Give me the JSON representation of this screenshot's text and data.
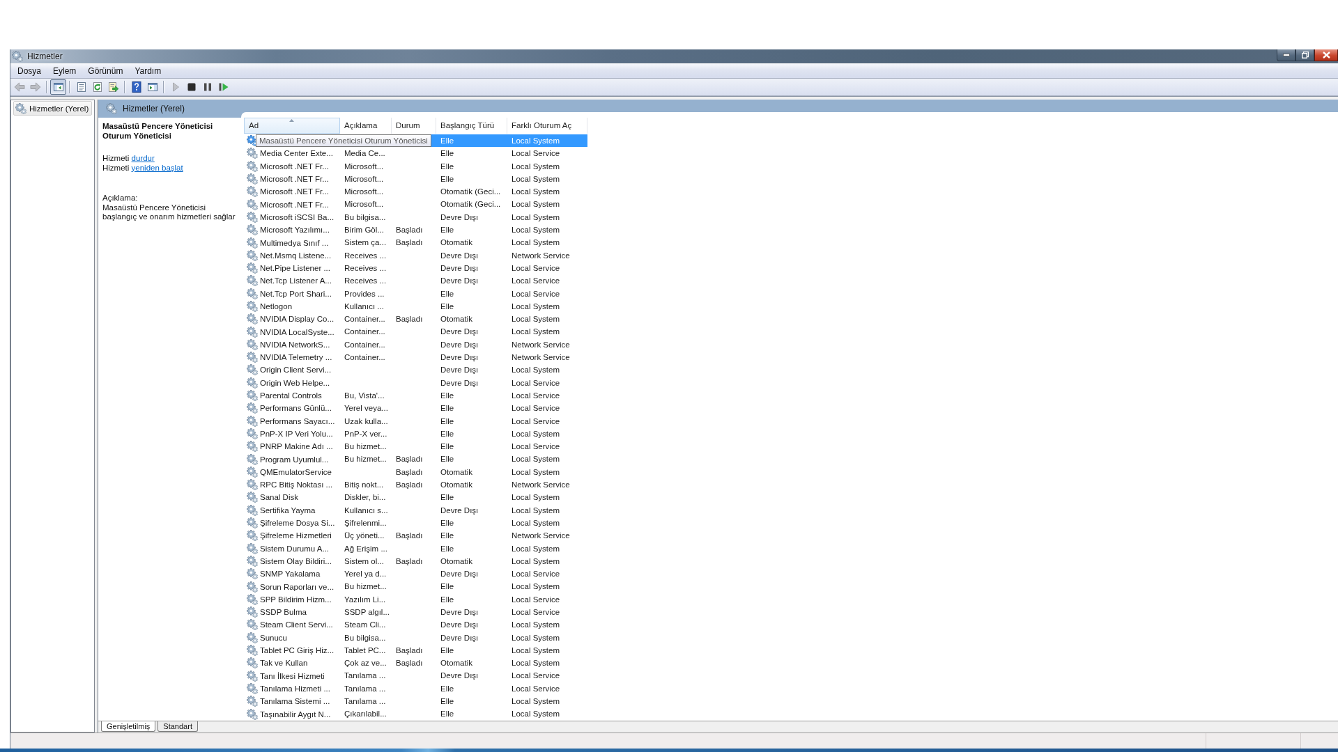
{
  "window": {
    "title": "Hizmetler"
  },
  "menu": [
    "Dosya",
    "Eylem",
    "Görünüm",
    "Yardım"
  ],
  "toolbar": {
    "groups": [
      [
        {
          "kind": "back",
          "disabled": true,
          "pressed": false
        },
        {
          "kind": "forward",
          "disabled": true,
          "pressed": false
        }
      ],
      [
        {
          "kind": "tree",
          "disabled": false,
          "pressed": true
        }
      ],
      [
        {
          "kind": "properties",
          "disabled": false,
          "pressed": false
        },
        {
          "kind": "refresh",
          "disabled": false,
          "pressed": false
        },
        {
          "kind": "export",
          "disabled": false,
          "pressed": false
        }
      ],
      [
        {
          "kind": "help",
          "disabled": false,
          "pressed": false
        },
        {
          "kind": "actions",
          "disabled": false,
          "pressed": false
        }
      ],
      [
        {
          "kind": "start",
          "disabled": true,
          "pressed": false
        },
        {
          "kind": "stop",
          "disabled": false,
          "pressed": false
        },
        {
          "kind": "pause",
          "disabled": false,
          "pressed": false
        },
        {
          "kind": "resume",
          "disabled": false,
          "pressed": false
        }
      ]
    ]
  },
  "tree": {
    "items": [
      {
        "label": "Hizmetler (Yerel)",
        "selected": true
      }
    ]
  },
  "panel": {
    "title": "Hizmetler (Yerel)"
  },
  "details": {
    "title": "Masaüstü Pencere Yöneticisi Oturum Yöneticisi",
    "actions": [
      {
        "text": "Hizmeti",
        "link": "durdur"
      },
      {
        "text": "Hizmeti",
        "link": "yeniden başlat"
      }
    ],
    "description_label": "Açıklama:",
    "description": "Masaüstü Pencere Yöneticisi başlangıç ve onarım hizmetleri sağlar"
  },
  "table": {
    "columns": [
      {
        "label": "Ad",
        "sorted": true
      },
      {
        "label": "Açıklama",
        "sorted": false
      },
      {
        "label": "Durum",
        "sorted": false
      },
      {
        "label": "Başlangıç Türü",
        "sorted": false
      },
      {
        "label": "Farklı Oturum Aç",
        "sorted": false
      }
    ],
    "rows": [
      {
        "name": "Masaüstü Pencere Yöneticisi Oturum Yöneticisi",
        "tooltip": true,
        "startup": "Elle",
        "logon": "Local System",
        "selected": true
      },
      {
        "name": "Media Center Exte...",
        "tooltip": false,
        "description": "Media Ce...",
        "startup": "Elle",
        "logon": "Local Service",
        "selected": false
      },
      {
        "name": "Microsoft .NET Fr...",
        "tooltip": false,
        "description": "Microsoft...",
        "startup": "Elle",
        "logon": "Local System",
        "selected": false
      },
      {
        "name": "Microsoft .NET Fr...",
        "tooltip": false,
        "description": "Microsoft...",
        "startup": "Elle",
        "logon": "Local System",
        "selected": false
      },
      {
        "name": "Microsoft .NET Fr...",
        "tooltip": false,
        "description": "Microsoft...",
        "startup": "Otomatik (Geci...",
        "logon": "Local System",
        "selected": false
      },
      {
        "name": "Microsoft .NET Fr...",
        "tooltip": false,
        "description": "Microsoft...",
        "startup": "Otomatik (Geci...",
        "logon": "Local System",
        "selected": false
      },
      {
        "name": "Microsoft iSCSI Ba...",
        "tooltip": false,
        "description": "Bu bilgisa...",
        "startup": "Devre Dışı",
        "logon": "Local System",
        "selected": false
      },
      {
        "name": "Microsoft Yazılımı...",
        "tooltip": false,
        "description": "Birim Göl...",
        "status": "Başladı",
        "startup": "Elle",
        "logon": "Local System",
        "selected": false
      },
      {
        "name": "Multimedya Sınıf ...",
        "tooltip": false,
        "description": "Sistem ça...",
        "status": "Başladı",
        "startup": "Otomatik",
        "logon": "Local System",
        "selected": false
      },
      {
        "name": "Net.Msmq Listene...",
        "tooltip": false,
        "description": "Receives ...",
        "startup": "Devre Dışı",
        "logon": "Network Service",
        "selected": false
      },
      {
        "name": "Net.Pipe Listener ...",
        "tooltip": false,
        "description": "Receives ...",
        "startup": "Devre Dışı",
        "logon": "Local Service",
        "selected": false
      },
      {
        "name": "Net.Tcp Listener A...",
        "tooltip": false,
        "description": "Receives ...",
        "startup": "Devre Dışı",
        "logon": "Local Service",
        "selected": false
      },
      {
        "name": "Net.Tcp Port Shari...",
        "tooltip": false,
        "description": "Provides ...",
        "startup": "Elle",
        "logon": "Local Service",
        "selected": false
      },
      {
        "name": "Netlogon",
        "tooltip": false,
        "description": "Kullanıcı ...",
        "startup": "Elle",
        "logon": "Local System",
        "selected": false
      },
      {
        "name": "NVIDIA Display Co...",
        "tooltip": false,
        "description": "Container...",
        "status": "Başladı",
        "startup": "Otomatik",
        "logon": "Local System",
        "selected": false
      },
      {
        "name": "NVIDIA LocalSyste...",
        "tooltip": false,
        "description": "Container...",
        "startup": "Devre Dışı",
        "logon": "Local System",
        "selected": false
      },
      {
        "name": "NVIDIA NetworkS...",
        "tooltip": false,
        "description": "Container...",
        "startup": "Devre Dışı",
        "logon": "Network Service",
        "selected": false
      },
      {
        "name": "NVIDIA Telemetry ...",
        "tooltip": false,
        "description": "Container...",
        "startup": "Devre Dışı",
        "logon": "Network Service",
        "selected": false
      },
      {
        "name": "Origin Client Servi...",
        "tooltip": false,
        "startup": "Devre Dışı",
        "logon": "Local System",
        "selected": false
      },
      {
        "name": "Origin Web Helpe...",
        "tooltip": false,
        "startup": "Devre Dışı",
        "logon": "Local Service",
        "selected": false
      },
      {
        "name": "Parental Controls",
        "tooltip": false,
        "description": "Bu, Vista'...",
        "startup": "Elle",
        "logon": "Local Service",
        "selected": false
      },
      {
        "name": "Performans Günlü...",
        "tooltip": false,
        "description": "Yerel veya...",
        "startup": "Elle",
        "logon": "Local Service",
        "selected": false
      },
      {
        "name": "Performans Sayacı...",
        "tooltip": false,
        "description": "Uzak kulla...",
        "startup": "Elle",
        "logon": "Local Service",
        "selected": false
      },
      {
        "name": "PnP-X IP Veri Yolu...",
        "tooltip": false,
        "description": "PnP-X ver...",
        "startup": "Elle",
        "logon": "Local System",
        "selected": false
      },
      {
        "name": "PNRP Makine Adı ...",
        "tooltip": false,
        "description": "Bu hizmet...",
        "startup": "Elle",
        "logon": "Local Service",
        "selected": false
      },
      {
        "name": "Program Uyumlul...",
        "tooltip": false,
        "description": "Bu hizmet...",
        "status": "Başladı",
        "startup": "Elle",
        "logon": "Local System",
        "selected": false
      },
      {
        "name": "QMEmulatorService",
        "tooltip": false,
        "status": "Başladı",
        "startup": "Otomatik",
        "logon": "Local System",
        "selected": false
      },
      {
        "name": "RPC Bitiş Noktası ...",
        "tooltip": false,
        "description": "Bitiş nokt...",
        "status": "Başladı",
        "startup": "Otomatik",
        "logon": "Network Service",
        "selected": false
      },
      {
        "name": "Sanal Disk",
        "tooltip": false,
        "description": "Diskler, bi...",
        "startup": "Elle",
        "logon": "Local System",
        "selected": false
      },
      {
        "name": "Sertifika Yayma",
        "tooltip": false,
        "description": "Kullanıcı s...",
        "startup": "Devre Dışı",
        "logon": "Local System",
        "selected": false
      },
      {
        "name": "Şifreleme Dosya Si...",
        "tooltip": false,
        "description": "Şifrelenmi...",
        "startup": "Elle",
        "logon": "Local System",
        "selected": false
      },
      {
        "name": "Şifreleme Hizmetleri",
        "tooltip": false,
        "description": "Üç yöneti...",
        "status": "Başladı",
        "startup": "Elle",
        "logon": "Network Service",
        "selected": false
      },
      {
        "name": "Sistem Durumu A...",
        "tooltip": false,
        "description": "Ağ Erişim ...",
        "startup": "Elle",
        "logon": "Local System",
        "selected": false
      },
      {
        "name": "Sistem Olay Bildiri...",
        "tooltip": false,
        "description": "Sistem ol...",
        "status": "Başladı",
        "startup": "Otomatik",
        "logon": "Local System",
        "selected": false
      },
      {
        "name": "SNMP Yakalama",
        "tooltip": false,
        "description": "Yerel ya d...",
        "startup": "Devre Dışı",
        "logon": "Local Service",
        "selected": false
      },
      {
        "name": "Sorun Raporları ve...",
        "tooltip": false,
        "description": "Bu hizmet...",
        "startup": "Elle",
        "logon": "Local System",
        "selected": false
      },
      {
        "name": "SPP Bildirim Hizm...",
        "tooltip": false,
        "description": "Yazılım Li...",
        "startup": "Elle",
        "logon": "Local Service",
        "selected": false
      },
      {
        "name": "SSDP Bulma",
        "tooltip": false,
        "description": "SSDP algıl...",
        "startup": "Devre Dışı",
        "logon": "Local Service",
        "selected": false
      },
      {
        "name": "Steam Client Servi...",
        "tooltip": false,
        "description": "Steam Cli...",
        "startup": "Devre Dışı",
        "logon": "Local System",
        "selected": false
      },
      {
        "name": "Sunucu",
        "tooltip": false,
        "description": "Bu bilgisa...",
        "startup": "Devre Dışı",
        "logon": "Local System",
        "selected": false
      },
      {
        "name": "Tablet PC Giriş Hiz...",
        "tooltip": false,
        "description": "Tablet PC...",
        "status": "Başladı",
        "startup": "Elle",
        "logon": "Local System",
        "selected": false
      },
      {
        "name": "Tak ve Kullan",
        "tooltip": false,
        "description": "Çok az ve...",
        "status": "Başladı",
        "startup": "Otomatik",
        "logon": "Local System",
        "selected": false
      },
      {
        "name": "Tanı İlkesi Hizmeti",
        "tooltip": false,
        "description": "Tanılama ...",
        "startup": "Devre Dışı",
        "logon": "Local Service",
        "selected": false
      },
      {
        "name": "Tanılama Hizmeti ...",
        "tooltip": false,
        "description": "Tanılama ...",
        "startup": "Elle",
        "logon": "Local Service",
        "selected": false
      },
      {
        "name": "Tanılama Sistemi ...",
        "tooltip": false,
        "description": "Tanılama ...",
        "startup": "Elle",
        "logon": "Local System",
        "selected": false
      },
      {
        "name": "Taşınabilir Aygıt N...",
        "tooltip": false,
        "description": "Çıkarılabil...",
        "startup": "Elle",
        "logon": "Local System",
        "selected": false
      }
    ]
  },
  "view_tabs": [
    {
      "label": "Genişletilmiş",
      "selected": true
    },
    {
      "label": "Standart",
      "selected": false
    }
  ]
}
